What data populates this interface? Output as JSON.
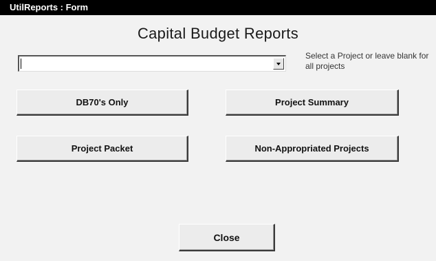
{
  "window": {
    "title": "UtilReports : Form"
  },
  "form": {
    "heading": "Capital Budget Reports",
    "project_select": {
      "value": "",
      "hint": "Select a Project or leave blank for all projects"
    },
    "buttons": {
      "db70_only": "DB70's Only",
      "project_summary": "Project Summary",
      "project_packet": "Project Packet",
      "non_appropriated": "Non-Appropriated Projects",
      "close": "Close"
    }
  },
  "icons": {
    "dropdown": "chevron-down-icon"
  }
}
